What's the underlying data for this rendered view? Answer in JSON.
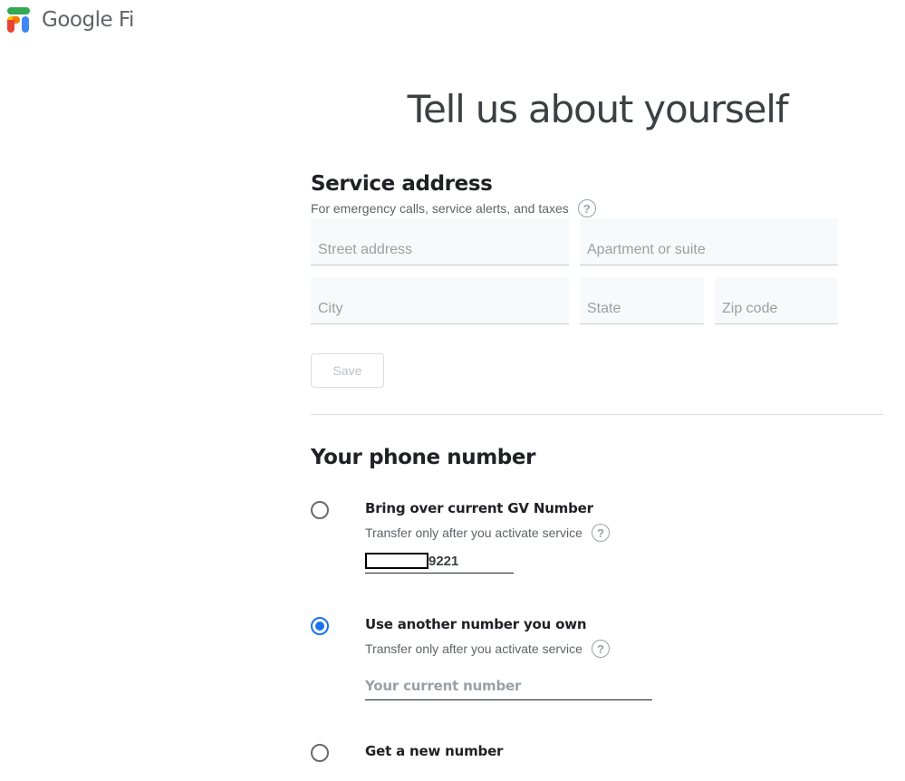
{
  "brand": {
    "name": "Google Fi",
    "logo_icon": "google-fi-logo"
  },
  "page": {
    "title": "Tell us about yourself"
  },
  "service_address": {
    "title": "Service address",
    "subtitle": "For emergency calls, service alerts, and taxes",
    "help_icon": "question-circle-icon",
    "fields": {
      "street": {
        "placeholder": "Street address",
        "value": ""
      },
      "apartment": {
        "placeholder": "Apartment or suite",
        "value": ""
      },
      "city": {
        "placeholder": "City",
        "value": ""
      },
      "state": {
        "placeholder": "State",
        "value": ""
      },
      "zip": {
        "placeholder": "Zip code",
        "value": ""
      }
    },
    "save_label": "Save",
    "save_disabled": true
  },
  "phone_number": {
    "title": "Your phone number",
    "selected": "use_another",
    "options": [
      {
        "id": "bring_gv",
        "label": "Bring over current GV Number",
        "sublabel": "Transfer only after you activate service",
        "number_suffix": "9221",
        "number_redacted": true,
        "checked": false
      },
      {
        "id": "use_another",
        "label": "Use another number you own",
        "sublabel": "Transfer only after you activate service",
        "input_placeholder": "Your current number",
        "input_value": "",
        "checked": true
      },
      {
        "id": "new_number",
        "label": "Get a new number",
        "checked": false
      }
    ]
  },
  "colors": {
    "accent": "#1a73e8",
    "text_primary": "#202124",
    "text_secondary": "#5f6368",
    "placeholder": "#9aa0a6",
    "field_bg": "#f8f9fa"
  }
}
